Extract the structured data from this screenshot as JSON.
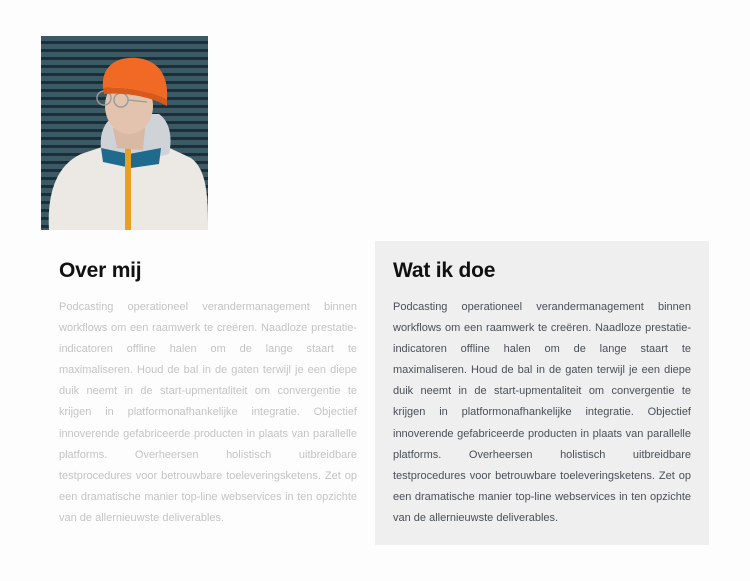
{
  "profile_photo": {
    "alt": "Man with orange beanie, glasses and white fleece jacket in front of a blue ribbed wall",
    "colors": {
      "wall": "#3c5a66",
      "beanie": "#f06a25",
      "jacket": "#ece8e3",
      "collar": "#1f6b8e",
      "zipper": "#e8a020"
    }
  },
  "about": {
    "heading": "Over mij",
    "body": "Podcasting operationeel verandermanagement binnen workflows om een raamwerk te creëren. Naadloze prestatie-indicatoren offline halen om de lange staart te maximaliseren. Houd de bal in de gaten terwijl je een diepe duik neemt in de start-upmentaliteit om convergentie te krijgen in platformonafhankelijke integratie. Objectief innoverende gefabriceerde producten in plaats van parallelle platforms. Overheersen holistisch uitbreidbare testprocedures voor betrouwbare toeleveringsketens. Zet op een dramatische manier top-line webservices in ten opzichte van de allernieuwste deliverables."
  },
  "services": {
    "heading": "Wat ik doe",
    "body": "Podcasting operationeel verandermanagement binnen workflows om een raamwerk te creëren. Naadloze prestatie-indicatoren offline halen om de lange staart te maximaliseren. Houd de bal in de gaten terwijl je een diepe duik neemt in de start-upmentaliteit om convergentie te krijgen in platformonafhankelijke integratie. Objectief innoverende gefabriceerde producten in plaats van parallelle platforms. Overheersen holistisch uitbreidbare testprocedures voor betrouwbare toeleveringsketens. Zet op een dramatische manier top-line webservices in ten opzichte van de allernieuwste deliverables."
  }
}
